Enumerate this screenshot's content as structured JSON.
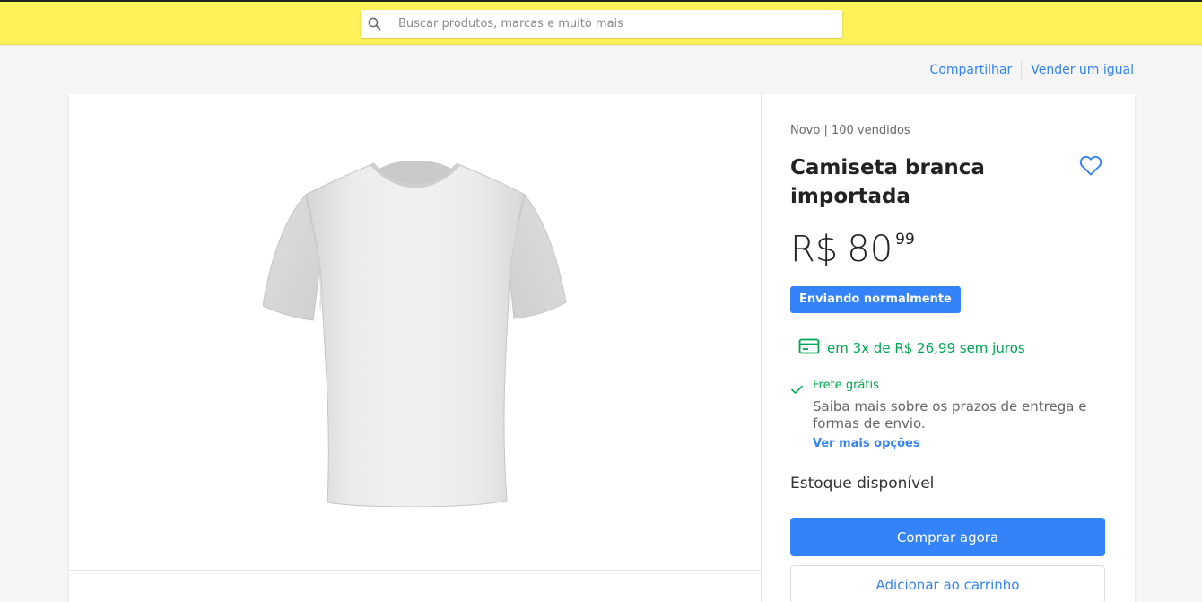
{
  "search": {
    "placeholder": "Buscar produtos, marcas e muito mais",
    "icon": "search-icon"
  },
  "actions": {
    "share_label": "Compartilhar",
    "sell_similar_label": "Vender um igual"
  },
  "product": {
    "condition_sales": "Novo | 100 vendidos",
    "title": "Camiseta branca importada",
    "price": {
      "currency": "R$",
      "amount": "80",
      "cents": "99"
    },
    "badge": "Enviando normalmente",
    "installments": "em 3x de R$ 26,99 sem juros",
    "shipping": {
      "free": "Frete grátis",
      "description": "Saiba mais sobre os prazos de entrega e formas de envio.",
      "more_options": "Ver mais opções"
    },
    "stock": "Estoque disponível",
    "image": "white-tshirt-photo"
  },
  "buttons": {
    "buy_now": "Comprar agora",
    "add_to_cart": "Adicionar ao carrinho"
  },
  "colors": {
    "header_yellow": "#fff159",
    "accent_blue": "#3483fa",
    "success_green": "#00a650"
  }
}
